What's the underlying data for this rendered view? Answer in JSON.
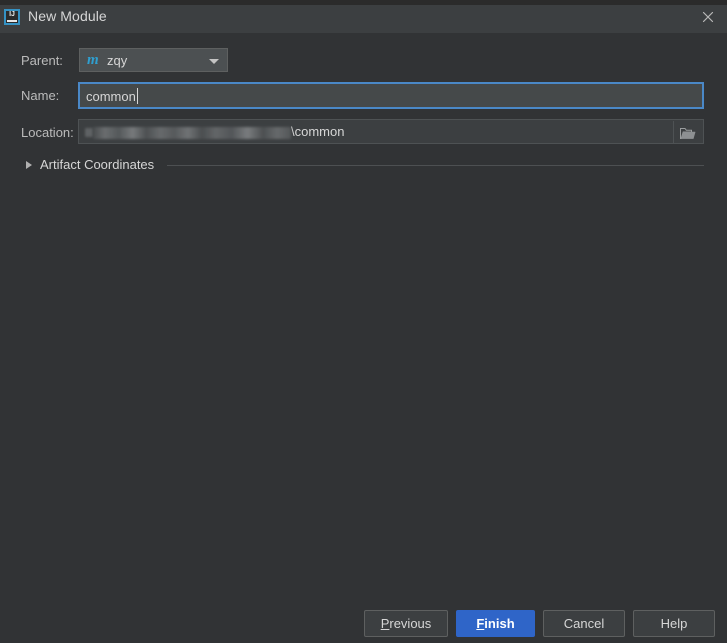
{
  "window": {
    "title": "New Module",
    "app_icon_text": "IJ",
    "close_icon": "close-icon"
  },
  "form": {
    "parent": {
      "label": "Parent:",
      "value": "zqy",
      "icon": "maven-module-icon",
      "icon_glyph": "m",
      "chevron_icon": "chevron-down-icon"
    },
    "name": {
      "label": "Name:",
      "value": "common",
      "placeholder": ""
    },
    "location": {
      "label": "Location:",
      "value_visible_tail": "\\common",
      "redacted": true,
      "browse_icon": "folder-open-icon"
    }
  },
  "artifact_coordinates": {
    "label": "Artifact Coordinates",
    "expanded": false,
    "expander_icon": "triangle-right-icon"
  },
  "buttons": {
    "previous": {
      "mnemonic": "P",
      "rest": "revious"
    },
    "finish": {
      "mnemonic": "F",
      "rest": "inish"
    },
    "cancel": {
      "label": "Cancel"
    },
    "help": {
      "label": "Help"
    }
  },
  "colors": {
    "dialog_background": "#313335",
    "title_bar_background": "#3c3f41",
    "accent_blue": "#2f65c8",
    "focus_border": "#4a88c7",
    "maven_icon_blue": "#2f9fd0",
    "text_primary": "#d6d6d6",
    "text_label": "#bbbbbb"
  }
}
